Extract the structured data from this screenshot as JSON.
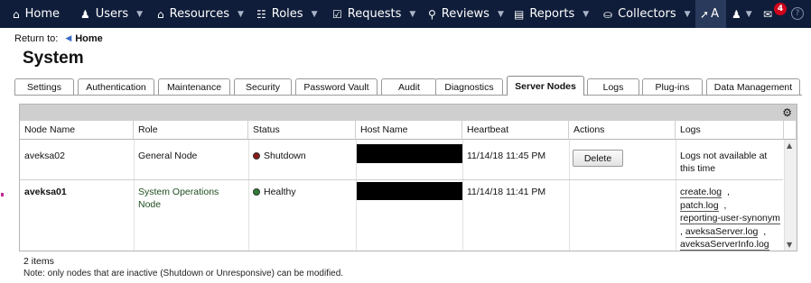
{
  "nav": {
    "items": [
      {
        "label": "Home",
        "icon": "home-icon"
      },
      {
        "label": "Users",
        "icon": "user-icon"
      },
      {
        "label": "Resources",
        "icon": "bank-icon"
      },
      {
        "label": "Roles",
        "icon": "org-chart-icon"
      },
      {
        "label": "Requests",
        "icon": "checkbox-icon"
      },
      {
        "label": "Reviews",
        "icon": "lightbulb-icon"
      },
      {
        "label": "Reports",
        "icon": "bar-chart-icon"
      },
      {
        "label": "Collectors",
        "icon": "database-icon"
      }
    ],
    "rocket_label": "A",
    "notification_count": "4",
    "help_glyph": "?"
  },
  "breadcrumb": {
    "return_label": "Return to:",
    "home_link": "Home"
  },
  "page": {
    "title": "System"
  },
  "tabs": [
    {
      "label": "Settings"
    },
    {
      "label": "Authentication"
    },
    {
      "label": "Maintenance"
    },
    {
      "label": "Security"
    },
    {
      "label": "Password Vault"
    },
    {
      "label": "Audit"
    },
    {
      "label": "Diagnostics"
    },
    {
      "label": "Server Nodes",
      "active": true
    },
    {
      "label": "Logs"
    },
    {
      "label": "Plug-ins"
    },
    {
      "label": "Data Management"
    }
  ],
  "table": {
    "columns": [
      "Node Name",
      "Role",
      "Status",
      "Host Name",
      "Heartbeat",
      "Actions",
      "Logs"
    ],
    "rows": [
      {
        "node_name": "aveksa02",
        "role": "General Node",
        "status": "Shutdown",
        "status_color": "#8b1a1a",
        "heartbeat": "11/14/18 11:45 PM",
        "action": "Delete",
        "logs_text": "Logs not available at this time"
      },
      {
        "node_name": "aveksa01",
        "role_line1": "System Operations",
        "role_line2": "Node",
        "role_color": "#1f4d1f",
        "status": "Healthy",
        "status_color": "#2e7d32",
        "heartbeat": "11/14/18 11:41 PM",
        "logs": [
          "create.log",
          "patch.log",
          "reporting-user-synonym",
          "aveksaServer.log",
          "aveksaServerInfo.log"
        ],
        "log_separator": ",",
        "log_separator_leading": ","
      }
    ]
  },
  "footer": {
    "count": "2 items",
    "note": "Note: only nodes that are inactive (Shutdown or Unresponsive) can be modified."
  }
}
